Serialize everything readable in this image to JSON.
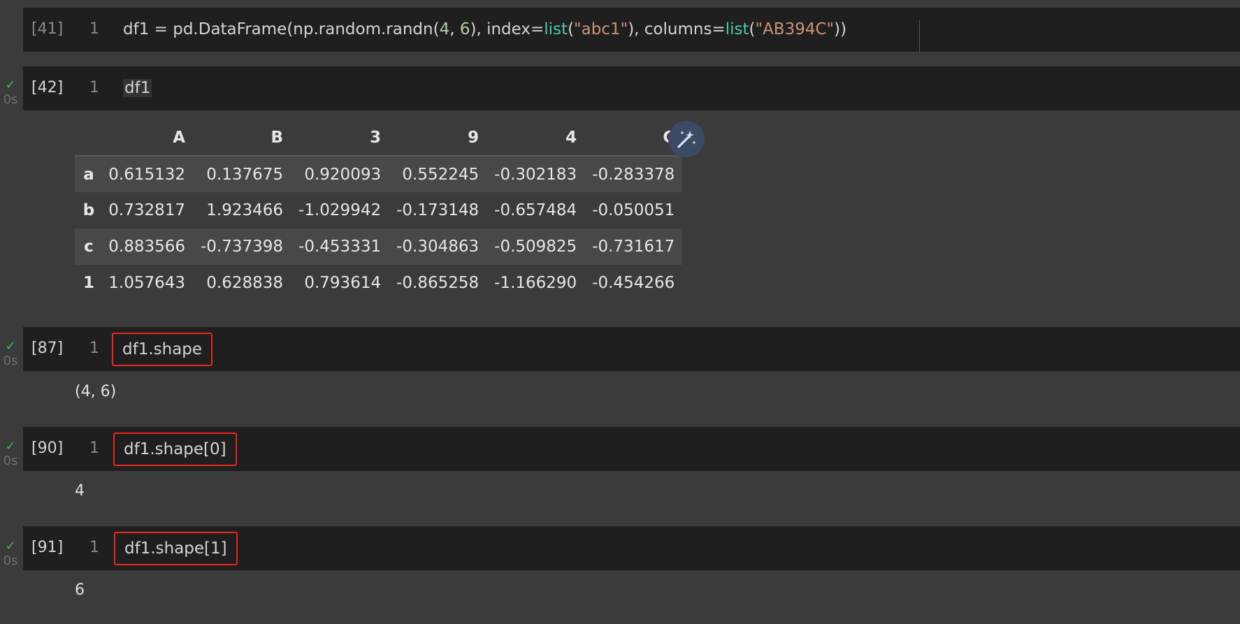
{
  "cells": [
    {
      "exec": "[41]",
      "line": "1",
      "code_tokens": [
        {
          "t": "df1 = pd.DataFrame(np.random.randn(",
          "c": ""
        },
        {
          "t": "4",
          "c": "num"
        },
        {
          "t": ", ",
          "c": ""
        },
        {
          "t": "6",
          "c": "num"
        },
        {
          "t": "), index=",
          "c": ""
        },
        {
          "t": "list",
          "c": "fn"
        },
        {
          "t": "(",
          "c": ""
        },
        {
          "t": "\"abc1\"",
          "c": "str"
        },
        {
          "t": "), columns=",
          "c": ""
        },
        {
          "t": "list",
          "c": "fn"
        },
        {
          "t": "(",
          "c": ""
        },
        {
          "t": "\"AB394C\"",
          "c": "str"
        },
        {
          "t": "))",
          "c": ""
        }
      ]
    },
    {
      "exec": "[42]",
      "line": "1",
      "code": "df1",
      "status": {
        "check": "✓",
        "time": "0s"
      }
    },
    {
      "exec": "[87]",
      "line": "1",
      "code": "df1.shape",
      "status": {
        "check": "✓",
        "time": "0s"
      },
      "output": "(4, 6)"
    },
    {
      "exec": "[90]",
      "line": "1",
      "code": "df1.shape[0]",
      "status": {
        "check": "✓",
        "time": "0s"
      },
      "output": "4"
    },
    {
      "exec": "[91]",
      "line": "1",
      "code": "df1.shape[1]",
      "status": {
        "check": "✓",
        "time": "0s"
      },
      "output": "6"
    }
  ],
  "dataframe": {
    "columns": [
      "A",
      "B",
      "3",
      "9",
      "4",
      "C"
    ],
    "rows": [
      {
        "index": "a",
        "values": [
          "0.615132",
          "0.137675",
          "0.920093",
          "0.552245",
          "-0.302183",
          "-0.283378"
        ]
      },
      {
        "index": "b",
        "values": [
          "0.732817",
          "1.923466",
          "-1.029942",
          "-0.173148",
          "-0.657484",
          "-0.050051"
        ]
      },
      {
        "index": "c",
        "values": [
          "0.883566",
          "-0.737398",
          "-0.453331",
          "-0.304863",
          "-0.509825",
          "-0.731617"
        ]
      },
      {
        "index": "1",
        "values": [
          "1.057643",
          "0.628838",
          "0.793614",
          "-0.865258",
          "-1.166290",
          "-0.454266"
        ]
      }
    ]
  },
  "icons": {
    "status_check": "check-icon",
    "data_wrangler": "magic-wand-icon"
  },
  "colors": {
    "check": "#3fb950",
    "highlight_box": "#e8281c",
    "fn": "#4ec9b0",
    "str": "#ce9178",
    "num": "#b5cea8"
  }
}
